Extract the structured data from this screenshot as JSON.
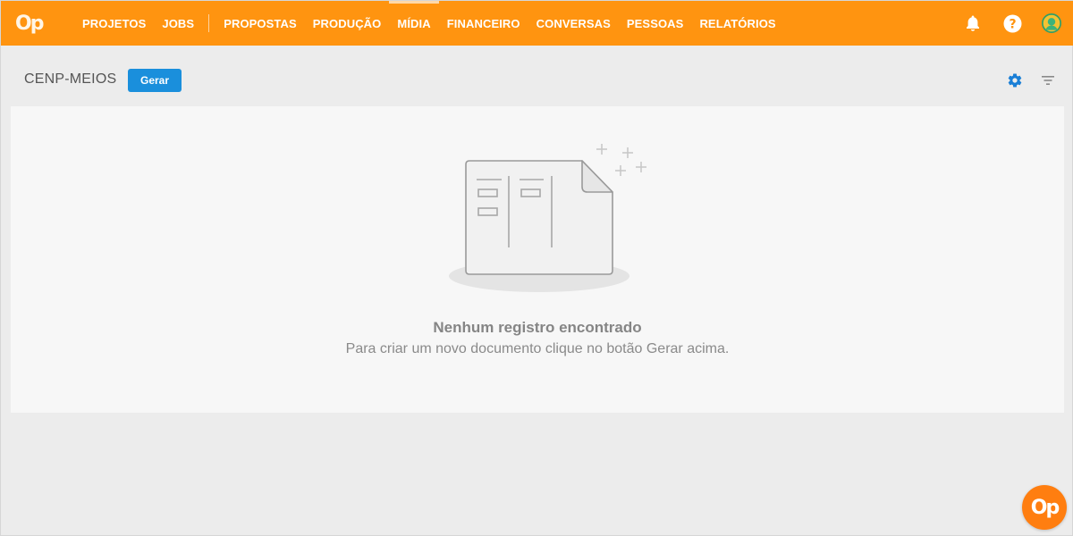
{
  "topbar": {
    "logo_text": "Op",
    "nav": [
      {
        "label": "PROJETOS"
      },
      {
        "label": "JOBS"
      },
      {
        "label": "PROPOSTAS"
      },
      {
        "label": "PRODUÇÃO"
      },
      {
        "label": "MÍDIA",
        "active": true
      },
      {
        "label": "FINANCEIRO"
      },
      {
        "label": "CONVERSAS"
      },
      {
        "label": "PESSOAS"
      },
      {
        "label": "RELATÓRIOS"
      }
    ],
    "icons": [
      "bell-icon",
      "help-icon",
      "avatar"
    ]
  },
  "subheader": {
    "title": "CENP-MEIOS",
    "gerar_label": "Gerar",
    "icons": [
      "gear-icon",
      "filter-icon"
    ]
  },
  "empty_state": {
    "title": "Nenhum registro encontrado",
    "subtitle": "Para criar um novo documento clique no botão Gerar acima."
  },
  "fab": {
    "label": "Op"
  },
  "colors": {
    "topbar": "#ff9410",
    "button": "#1a8fdc",
    "gear": "#1a7fd6",
    "fab": "#ff7e10"
  }
}
